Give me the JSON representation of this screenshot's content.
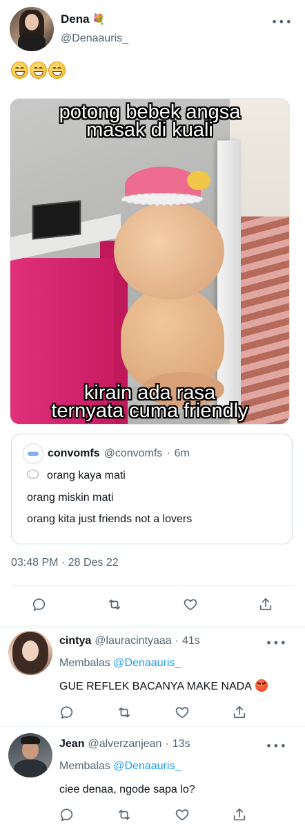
{
  "tweet": {
    "name": "Dena",
    "handle": "@Denaauris_",
    "more": "•••",
    "name_emoji": "💐",
    "emoji_text": "😁😁😁",
    "image": {
      "top_text": "potong bebek angsa masak di kuali",
      "bottom_text": "kirain ada rasa ternyata cuma friendly"
    },
    "quote": {
      "name": "convomfs",
      "handle": "@convomfs",
      "dot": "·",
      "time": "6m",
      "lines": [
        "orang kaya mati",
        "orang miskin mati",
        "orang kita just friends not a lovers"
      ]
    },
    "timestamp": "03:48 PM · 28 Des 22"
  },
  "actions": [
    "reply-icon",
    "retweet-icon",
    "like-icon",
    "share-icon"
  ],
  "replies": [
    {
      "name": "cintya",
      "handle": "@lauracintyaaa",
      "dot": "·",
      "time": "41s",
      "replying_prefix": "Membalas",
      "replying_to": "@Denaauris_",
      "text": "GUE REFLEK BACANYA MAKE NADA",
      "more": "•••"
    },
    {
      "name": "Jean",
      "handle": "@alverzanjean",
      "dot": "·",
      "time": "13s",
      "replying_prefix": "Membalas",
      "replying_to": "@Denaauris_",
      "text": "ciee denaa, ngode sapa lo?",
      "more": "•••"
    }
  ],
  "colors": {
    "link": "#1d9bf0",
    "muted": "#536471",
    "text": "#0f1419"
  }
}
